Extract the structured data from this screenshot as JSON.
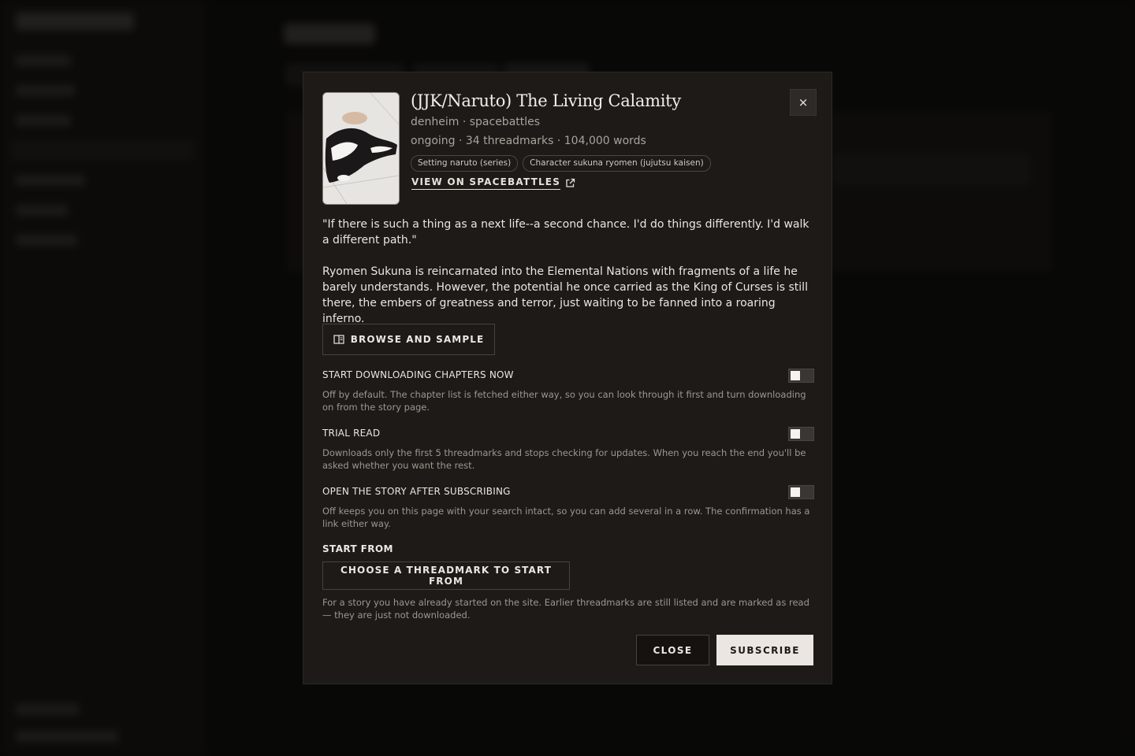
{
  "modal": {
    "title": "(JJK/Naruto) The Living Calamity",
    "author_line": "denheim · spacebattles",
    "stats_line": "ongoing · 34 threadmarks · 104,000 words",
    "tags": [
      "Setting naruto (series)",
      "Character sukuna ryomen (jujutsu kaisen)"
    ],
    "view_link": "VIEW ON SPACEBATTLES",
    "close_x": "×",
    "description": [
      "\"If there is such a thing as a next life--a second chance. I'd do things differently. I'd walk a different path.\"",
      "Ryomen Sukuna is reincarnated into the Elemental Nations with fragments of a life he barely understands. However, the potential he once carried as the King of Curses is still there, the embers of greatness and terror, just waiting to be fanned into a roaring inferno."
    ],
    "browse_button": "BROWSE AND SAMPLE",
    "options": [
      {
        "label": "START DOWNLOADING CHAPTERS NOW",
        "help": "Off by default. The chapter list is fetched either way, so you can look through it first and turn downloading on from the story page.",
        "on": false
      },
      {
        "label": "TRIAL READ",
        "help": "Downloads only the first 5 threadmarks and stops checking for updates. When you reach the end you'll be asked whether you want the rest.",
        "on": false
      },
      {
        "label": "OPEN THE STORY AFTER SUBSCRIBING",
        "help": "Off keeps you on this page with your search intact, so you can add several in a row. The confirmation has a link either way.",
        "on": false
      }
    ],
    "start_from": {
      "title": "START FROM",
      "button": "CHOOSE A THREADMARK TO START FROM",
      "help": "For a story you have already started on the site. Earlier threadmarks are still listed and are marked as read — they are just not downloaded."
    },
    "footer": {
      "close": "CLOSE",
      "subscribe": "SUBSCRIBE"
    }
  },
  "icons": {
    "close": "close-icon",
    "external_link": "external-link-icon",
    "book": "book-open-icon"
  },
  "colors": {
    "modal_bg": "#1d1a17",
    "primary_button": "#ebe6e1",
    "muted_text": "#a9a39c"
  }
}
